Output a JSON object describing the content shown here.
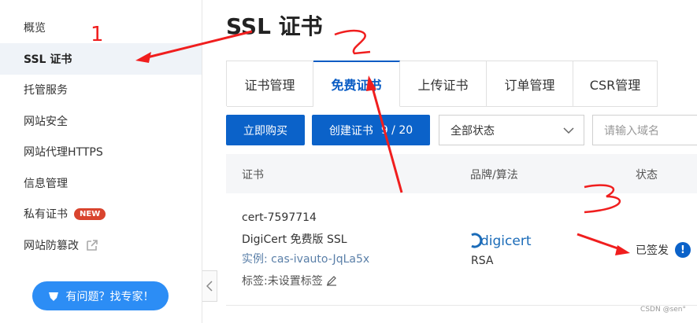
{
  "sidebar": {
    "items": [
      {
        "label": "概览"
      },
      {
        "label": "SSL 证书"
      },
      {
        "label": "托管服务"
      },
      {
        "label": "网站安全"
      },
      {
        "label": "网站代理HTTPS"
      },
      {
        "label": "信息管理"
      },
      {
        "label": "私有证书",
        "badge": "NEW"
      },
      {
        "label": "网站防篡改"
      }
    ],
    "help_button": "有问题？找专家！"
  },
  "page": {
    "title": "SSL 证书"
  },
  "tabs": [
    {
      "label": "证书管理"
    },
    {
      "label": "免费证书"
    },
    {
      "label": "上传证书"
    },
    {
      "label": "订单管理"
    },
    {
      "label": "CSR管理"
    }
  ],
  "toolbar": {
    "buy_button": "立即购买",
    "create_button": "创建证书",
    "create_count": "9 / 20",
    "status_select_value": "全部状态",
    "search_placeholder": "请输入域名"
  },
  "table": {
    "headers": {
      "cert": "证书",
      "brand": "品牌/算法",
      "status": "状态"
    },
    "rows": [
      {
        "cert_id": "cert-7597714",
        "cert_name": "DigiCert 免费版 SSL",
        "instance": "实例: cas-ivauto-JqLa5x",
        "tags": "标签:未设置标签",
        "brand_logo": "digicert",
        "algorithm": "RSA",
        "status": "已签发"
      }
    ]
  },
  "watermark": "CSDN @sen°",
  "annotations": {
    "n1": "1",
    "n2": "2",
    "n3": "3"
  },
  "colors": {
    "primary": "#0b62c9",
    "annotation": "#f01e1e",
    "badge": "#d9442e",
    "help": "#2c8df5"
  }
}
